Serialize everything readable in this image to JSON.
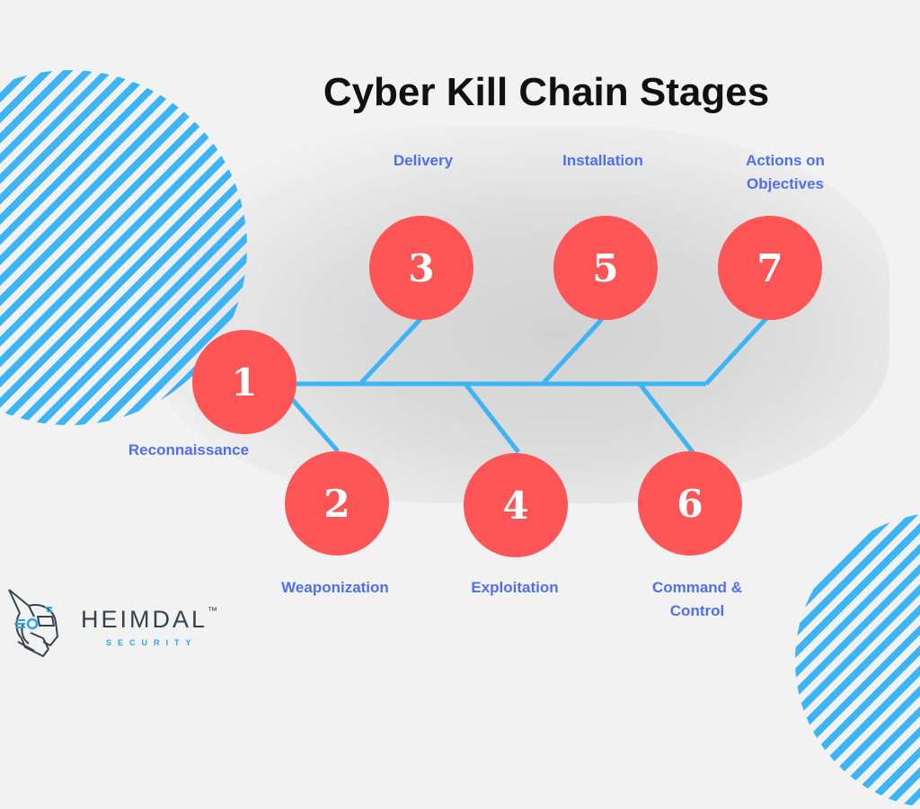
{
  "title": "Cyber Kill Chain Stages",
  "colors": {
    "node_fill": "#fe5656",
    "connector": "#3db4f5",
    "label_text": "#4f6ff0",
    "title_text": "#111111",
    "stripe": "#3db4f5"
  },
  "stages": [
    {
      "number": "1",
      "label": "Reconnaissance",
      "position": "below"
    },
    {
      "number": "2",
      "label": "Weaponization",
      "position": "below"
    },
    {
      "number": "3",
      "label": "Delivery",
      "position": "above"
    },
    {
      "number": "4",
      "label": "Exploitation",
      "position": "below"
    },
    {
      "number": "5",
      "label": "Installation",
      "position": "above"
    },
    {
      "number": "6",
      "label": "Command & Control",
      "position": "below"
    },
    {
      "number": "7",
      "label": "Actions on Objectives",
      "position": "above"
    }
  ],
  "labels_display": {
    "stage1": "Reconnaissance",
    "stage2": "Weaponization",
    "stage3": "Delivery",
    "stage4": "Exploitation",
    "stage5": "Installation",
    "stage6_line1": "Command &",
    "stage6_line2": "Control",
    "stage7_line1": "Actions on",
    "stage7_line2": "Objectives"
  },
  "logo": {
    "name": "HEIMDAL",
    "trademark": "™",
    "subtitle": "SECURITY"
  }
}
